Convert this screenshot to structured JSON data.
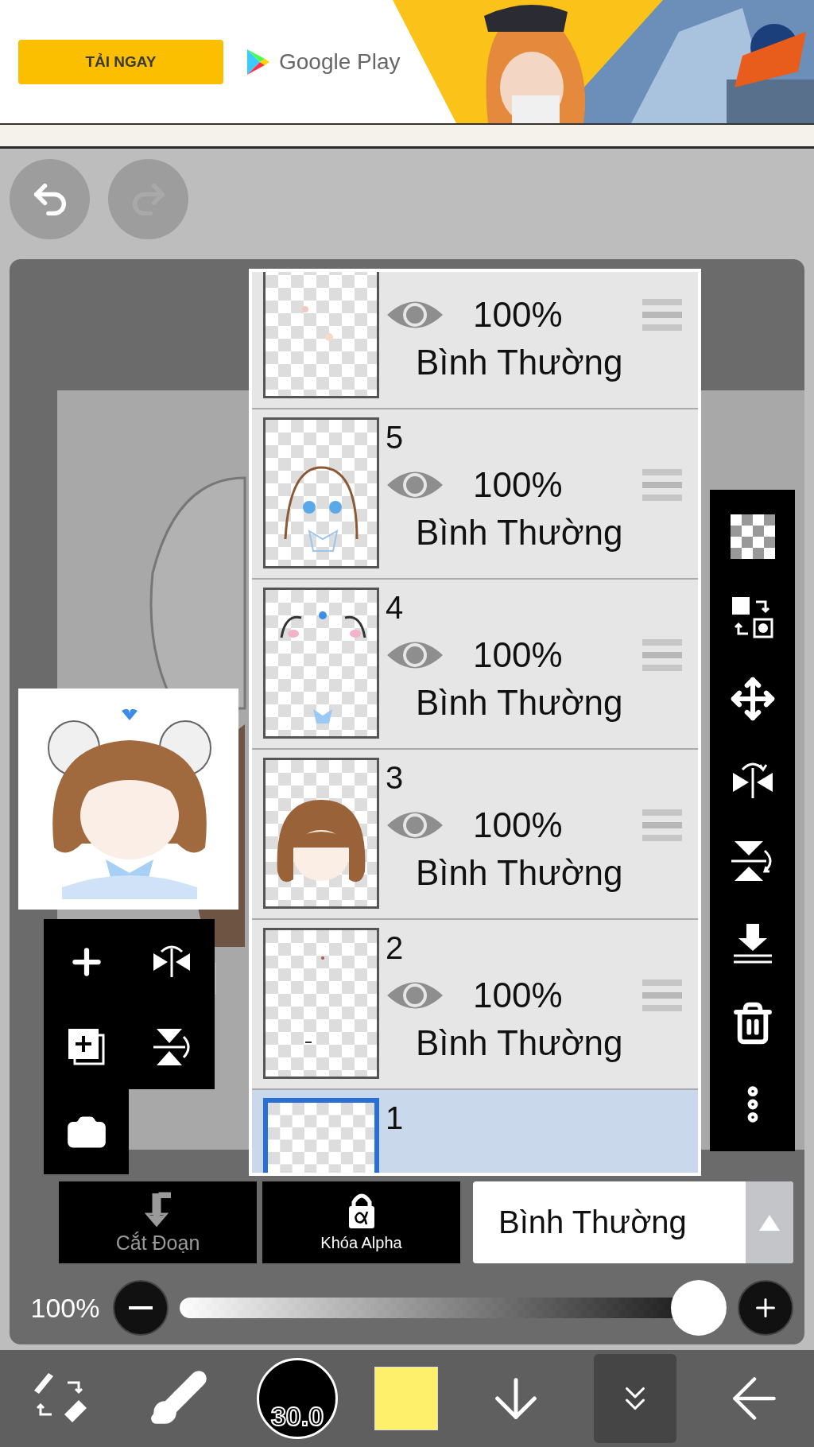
{
  "ad": {
    "button": "TẢI NGAY",
    "store": "Google Play"
  },
  "history": [
    {
      "kind": "undo",
      "disabled": false
    },
    {
      "kind": "redo",
      "disabled": true
    }
  ],
  "layers": [
    {
      "opacity": "100%",
      "blend": "Bình Thường",
      "visible": true,
      "selected": false
    },
    {
      "number": "5",
      "opacity": "100%",
      "blend": "Bình Thường",
      "visible": true,
      "selected": false
    },
    {
      "number": "4",
      "opacity": "100%",
      "blend": "Bình Thường",
      "visible": true,
      "selected": false
    },
    {
      "number": "3",
      "opacity": "100%",
      "blend": "Bình Thường",
      "visible": true,
      "selected": false
    },
    {
      "number": "2",
      "opacity": "100%",
      "blend": "Bình Thường",
      "visible": true,
      "selected": false
    },
    {
      "number": "1",
      "selected": true
    }
  ],
  "layer_options": [
    {
      "kind": "clipping",
      "label": "Cắt Đoạn",
      "disabled": true
    },
    {
      "kind": "alpha-lock",
      "label": "Khóa Alpha",
      "disabled": false
    }
  ],
  "blend_mode": {
    "value": "Bình Thường"
  },
  "opacity": {
    "reading": "100%",
    "level": 1
  },
  "toolbar": [
    {
      "kind": "tool-switch",
      "selected": false
    },
    {
      "kind": "brush",
      "selected": false
    },
    {
      "kind": "brush-size",
      "label": "30.0",
      "selected": false
    },
    {
      "kind": "color",
      "selected": false
    },
    {
      "kind": "down",
      "selected": false
    },
    {
      "kind": "collapse",
      "selected": true
    },
    {
      "kind": "back",
      "selected": false
    }
  ]
}
